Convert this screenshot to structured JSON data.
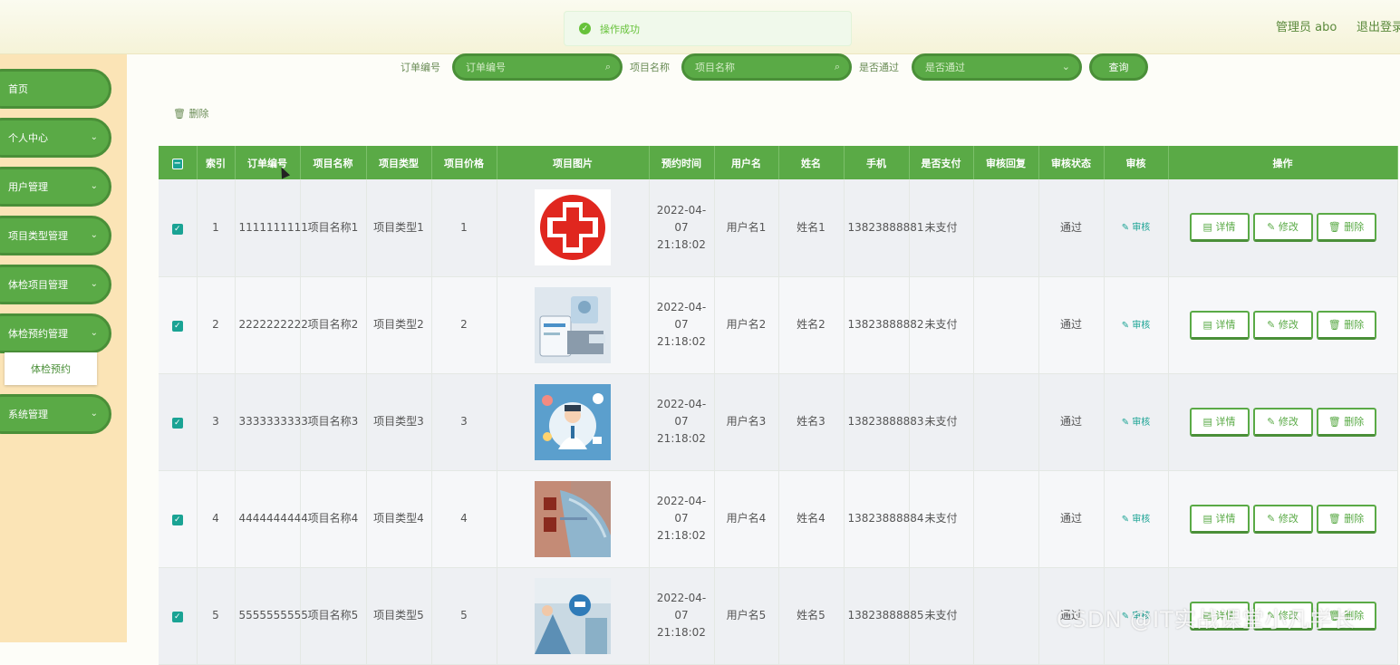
{
  "header": {
    "user": "管理员 abo",
    "logout": "退出登录"
  },
  "toast": {
    "icon": "check-circle-icon",
    "text": "操作成功"
  },
  "sidebar": {
    "items": [
      {
        "label": "首页",
        "has_children": false
      },
      {
        "label": "个人中心",
        "has_children": true
      },
      {
        "label": "用户管理",
        "has_children": true
      },
      {
        "label": "项目类型管理",
        "has_children": true
      },
      {
        "label": "体检项目管理",
        "has_children": true
      },
      {
        "label": "体检预约管理",
        "has_children": true
      },
      {
        "label": "系统管理",
        "has_children": true
      }
    ],
    "submenu_label": "体检预约"
  },
  "search": {
    "order_label": "订单编号",
    "order_placeholder": "订单编号",
    "project_label": "项目名称",
    "project_placeholder": "项目名称",
    "pass_label": "是否通过",
    "pass_placeholder": "是否通过",
    "query_button": "查询"
  },
  "toolbar": {
    "delete_label": "删除"
  },
  "table": {
    "headers": [
      "索引",
      "订单编号",
      "项目名称",
      "项目类型",
      "项目价格",
      "项目图片",
      "预约时间",
      "用户名",
      "姓名",
      "手机",
      "是否支付",
      "审核回复",
      "审核状态",
      "审核",
      "操作"
    ],
    "rows": [
      {
        "index": "1",
        "order": "1111111111",
        "name": "项目名称1",
        "type": "项目类型1",
        "price": "1",
        "time": "2022-04-07 21:18:02",
        "user": "用户名1",
        "real": "姓名1",
        "phone": "13823888881",
        "paid": "未支付",
        "reply": "",
        "status": "通过",
        "audit": "审核",
        "image": "red-cross-logo"
      },
      {
        "index": "2",
        "order": "2222222222",
        "name": "项目名称2",
        "type": "项目类型2",
        "price": "2",
        "time": "2022-04-07 21:18:02",
        "user": "用户名2",
        "real": "姓名2",
        "phone": "13823888882",
        "paid": "未支付",
        "reply": "",
        "status": "通过",
        "audit": "审核",
        "image": "medical-tablet-photo"
      },
      {
        "index": "3",
        "order": "3333333333",
        "name": "项目名称3",
        "type": "项目类型3",
        "price": "3",
        "time": "2022-04-07 21:18:02",
        "user": "用户名3",
        "real": "姓名3",
        "phone": "13823888883",
        "paid": "未支付",
        "reply": "",
        "status": "通过",
        "audit": "审核",
        "image": "doctor-illustration"
      },
      {
        "index": "4",
        "order": "4444444444",
        "name": "项目名称4",
        "type": "项目类型4",
        "price": "4",
        "time": "2022-04-07 21:18:02",
        "user": "用户名4",
        "real": "姓名4",
        "phone": "13823888884",
        "paid": "未支付",
        "reply": "",
        "status": "通过",
        "audit": "审核",
        "image": "mask-photo"
      },
      {
        "index": "5",
        "order": "5555555555",
        "name": "项目名称5",
        "type": "项目类型5",
        "price": "5",
        "time": "2022-04-07 21:18:02",
        "user": "用户名5",
        "real": "姓名5",
        "phone": "13823888885",
        "paid": "未支付",
        "reply": "",
        "status": "通过",
        "audit": "审核",
        "image": "clinic-photo"
      }
    ],
    "ops": {
      "detail": "详情",
      "edit": "修改",
      "delete": "删除"
    }
  },
  "watermark": "CSDN @IT实战课堂小凡学长",
  "colors": {
    "primary": "#5aaa46",
    "sidebar_bg": "#fbe4b6",
    "teal": "#1aa394"
  }
}
